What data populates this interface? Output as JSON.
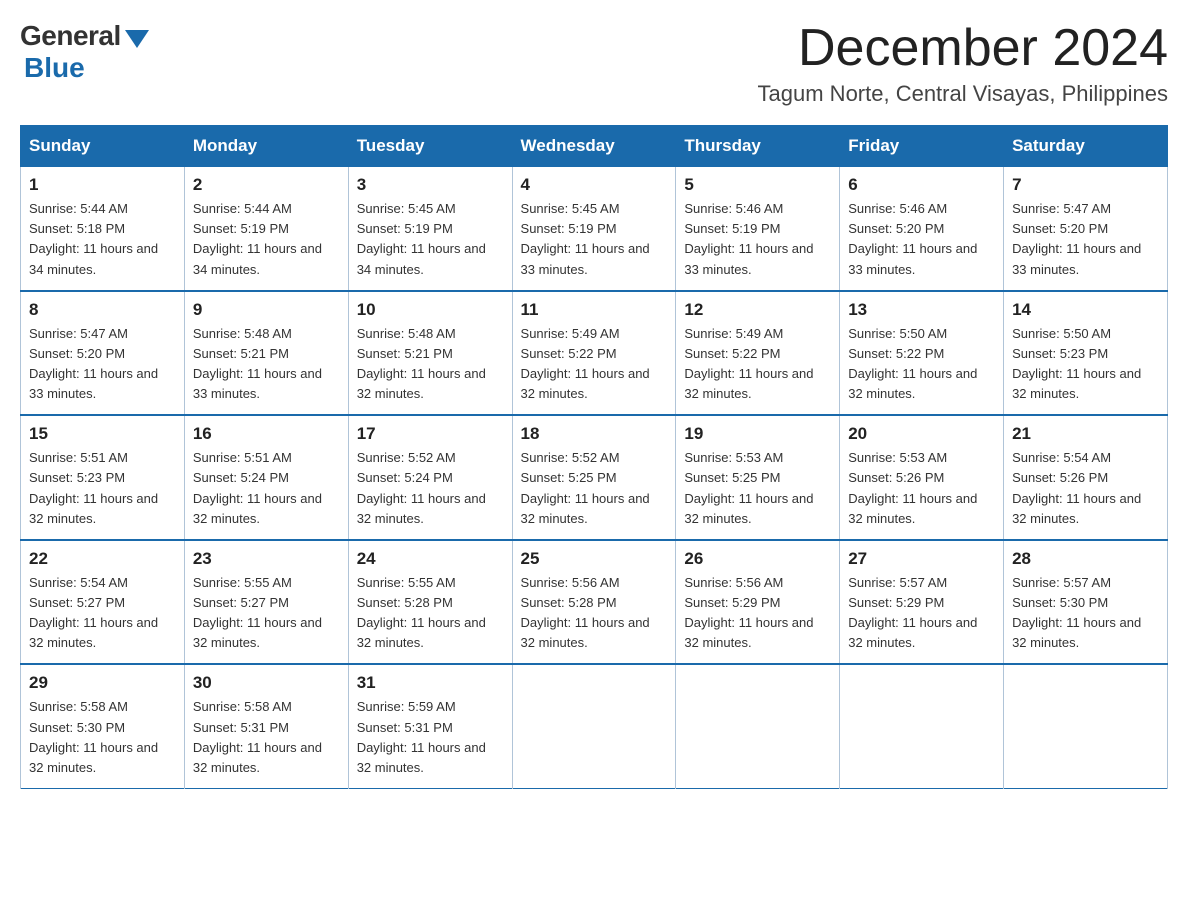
{
  "header": {
    "logo_general": "General",
    "logo_blue": "Blue",
    "month_title": "December 2024",
    "location": "Tagum Norte, Central Visayas, Philippines"
  },
  "weekdays": [
    "Sunday",
    "Monday",
    "Tuesday",
    "Wednesday",
    "Thursday",
    "Friday",
    "Saturday"
  ],
  "weeks": [
    [
      {
        "day": "1",
        "sunrise": "5:44 AM",
        "sunset": "5:18 PM",
        "daylight": "11 hours and 34 minutes."
      },
      {
        "day": "2",
        "sunrise": "5:44 AM",
        "sunset": "5:19 PM",
        "daylight": "11 hours and 34 minutes."
      },
      {
        "day": "3",
        "sunrise": "5:45 AM",
        "sunset": "5:19 PM",
        "daylight": "11 hours and 34 minutes."
      },
      {
        "day": "4",
        "sunrise": "5:45 AM",
        "sunset": "5:19 PM",
        "daylight": "11 hours and 33 minutes."
      },
      {
        "day": "5",
        "sunrise": "5:46 AM",
        "sunset": "5:19 PM",
        "daylight": "11 hours and 33 minutes."
      },
      {
        "day": "6",
        "sunrise": "5:46 AM",
        "sunset": "5:20 PM",
        "daylight": "11 hours and 33 minutes."
      },
      {
        "day": "7",
        "sunrise": "5:47 AM",
        "sunset": "5:20 PM",
        "daylight": "11 hours and 33 minutes."
      }
    ],
    [
      {
        "day": "8",
        "sunrise": "5:47 AM",
        "sunset": "5:20 PM",
        "daylight": "11 hours and 33 minutes."
      },
      {
        "day": "9",
        "sunrise": "5:48 AM",
        "sunset": "5:21 PM",
        "daylight": "11 hours and 33 minutes."
      },
      {
        "day": "10",
        "sunrise": "5:48 AM",
        "sunset": "5:21 PM",
        "daylight": "11 hours and 32 minutes."
      },
      {
        "day": "11",
        "sunrise": "5:49 AM",
        "sunset": "5:22 PM",
        "daylight": "11 hours and 32 minutes."
      },
      {
        "day": "12",
        "sunrise": "5:49 AM",
        "sunset": "5:22 PM",
        "daylight": "11 hours and 32 minutes."
      },
      {
        "day": "13",
        "sunrise": "5:50 AM",
        "sunset": "5:22 PM",
        "daylight": "11 hours and 32 minutes."
      },
      {
        "day": "14",
        "sunrise": "5:50 AM",
        "sunset": "5:23 PM",
        "daylight": "11 hours and 32 minutes."
      }
    ],
    [
      {
        "day": "15",
        "sunrise": "5:51 AM",
        "sunset": "5:23 PM",
        "daylight": "11 hours and 32 minutes."
      },
      {
        "day": "16",
        "sunrise": "5:51 AM",
        "sunset": "5:24 PM",
        "daylight": "11 hours and 32 minutes."
      },
      {
        "day": "17",
        "sunrise": "5:52 AM",
        "sunset": "5:24 PM",
        "daylight": "11 hours and 32 minutes."
      },
      {
        "day": "18",
        "sunrise": "5:52 AM",
        "sunset": "5:25 PM",
        "daylight": "11 hours and 32 minutes."
      },
      {
        "day": "19",
        "sunrise": "5:53 AM",
        "sunset": "5:25 PM",
        "daylight": "11 hours and 32 minutes."
      },
      {
        "day": "20",
        "sunrise": "5:53 AM",
        "sunset": "5:26 PM",
        "daylight": "11 hours and 32 minutes."
      },
      {
        "day": "21",
        "sunrise": "5:54 AM",
        "sunset": "5:26 PM",
        "daylight": "11 hours and 32 minutes."
      }
    ],
    [
      {
        "day": "22",
        "sunrise": "5:54 AM",
        "sunset": "5:27 PM",
        "daylight": "11 hours and 32 minutes."
      },
      {
        "day": "23",
        "sunrise": "5:55 AM",
        "sunset": "5:27 PM",
        "daylight": "11 hours and 32 minutes."
      },
      {
        "day": "24",
        "sunrise": "5:55 AM",
        "sunset": "5:28 PM",
        "daylight": "11 hours and 32 minutes."
      },
      {
        "day": "25",
        "sunrise": "5:56 AM",
        "sunset": "5:28 PM",
        "daylight": "11 hours and 32 minutes."
      },
      {
        "day": "26",
        "sunrise": "5:56 AM",
        "sunset": "5:29 PM",
        "daylight": "11 hours and 32 minutes."
      },
      {
        "day": "27",
        "sunrise": "5:57 AM",
        "sunset": "5:29 PM",
        "daylight": "11 hours and 32 minutes."
      },
      {
        "day": "28",
        "sunrise": "5:57 AM",
        "sunset": "5:30 PM",
        "daylight": "11 hours and 32 minutes."
      }
    ],
    [
      {
        "day": "29",
        "sunrise": "5:58 AM",
        "sunset": "5:30 PM",
        "daylight": "11 hours and 32 minutes."
      },
      {
        "day": "30",
        "sunrise": "5:58 AM",
        "sunset": "5:31 PM",
        "daylight": "11 hours and 32 minutes."
      },
      {
        "day": "31",
        "sunrise": "5:59 AM",
        "sunset": "5:31 PM",
        "daylight": "11 hours and 32 minutes."
      },
      null,
      null,
      null,
      null
    ]
  ]
}
